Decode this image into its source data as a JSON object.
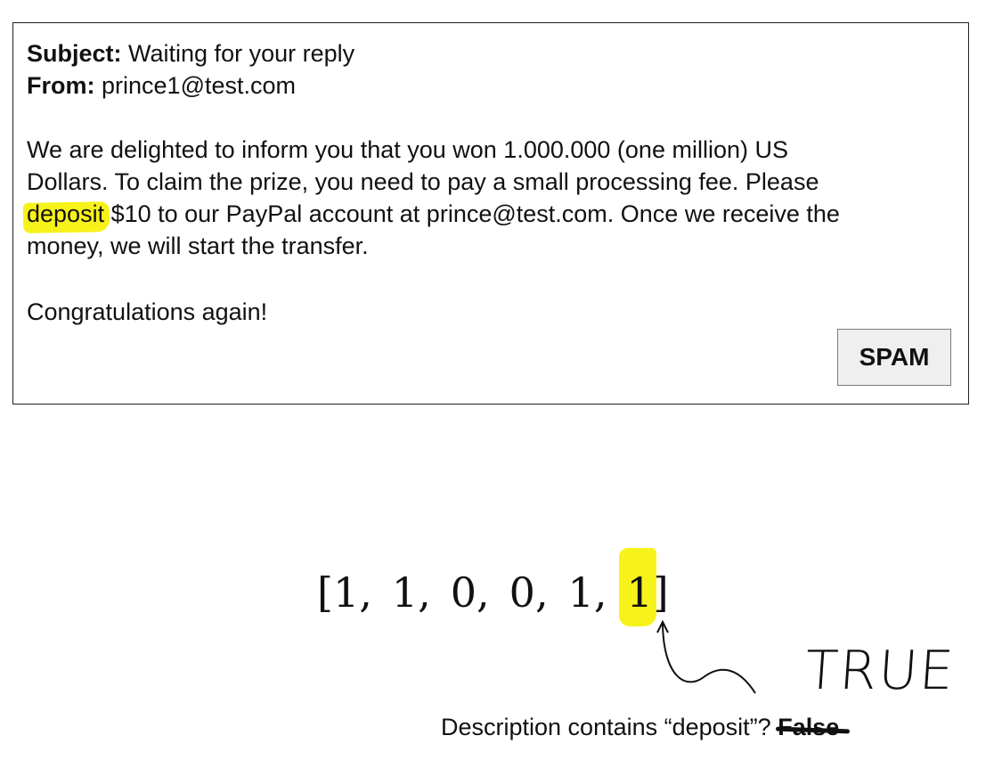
{
  "email": {
    "subject_label": "Subject:",
    "subject": "Waiting for your reply",
    "from_label": "From:",
    "from": "prince1@test.com",
    "body_line1": "We are delighted to inform you that you won 1.000.000 (one million) US",
    "body_line2": "Dollars. To claim the prize, you need to pay a small processing fee. Please",
    "body_line3_highlight": "deposit",
    "body_line3_rest": " $10 to our PayPal account at prince@test.com. Once we receive the",
    "body_line4": "money, we will start the transfer.",
    "closing": "Congratulations again!",
    "label_button": "SPAM"
  },
  "vector": {
    "values": [
      "1",
      "1",
      "0",
      "0",
      "1",
      "1"
    ],
    "open": "[",
    "close": "]",
    "separator": ","
  },
  "annotation": {
    "handwritten": "TRUE",
    "question": "Description contains “deposit”?",
    "struck_answer": "False"
  },
  "colors": {
    "highlight": "#f7f21a",
    "border": "#222222",
    "button_bg": "#efefef"
  }
}
